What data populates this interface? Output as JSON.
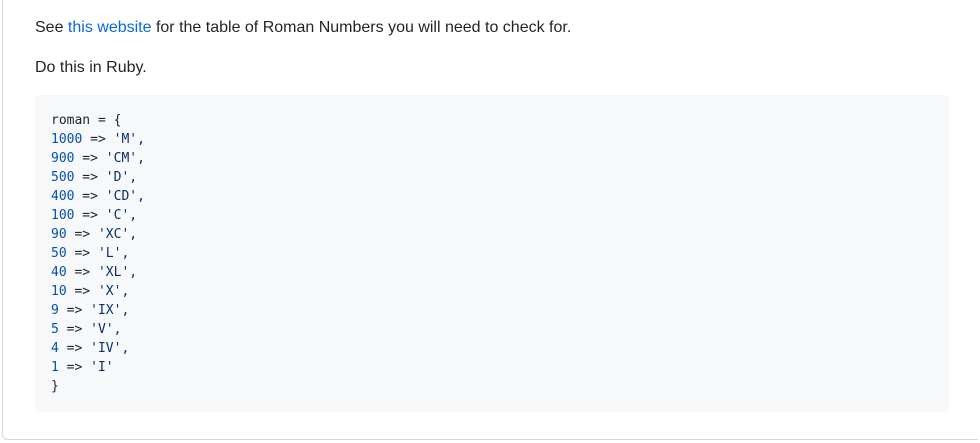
{
  "intro": {
    "prefix": "See ",
    "link_text": "this website",
    "suffix": " for the table of Roman Numbers you will need to check for."
  },
  "lang_note": "Do this in Ruby.",
  "code": {
    "open": "roman = {",
    "entries": [
      {
        "num": "1000",
        "arrow": " => ",
        "val": "'M',"
      },
      {
        "num": "900",
        "arrow": " => ",
        "val": "'CM',"
      },
      {
        "num": "500",
        "arrow": " => ",
        "val": "'D',"
      },
      {
        "num": "400",
        "arrow": " => ",
        "val": "'CD',"
      },
      {
        "num": "100",
        "arrow": " => ",
        "val": "'C',"
      },
      {
        "num": "90",
        "arrow": " => ",
        "val": "'XC',"
      },
      {
        "num": "50",
        "arrow": " => ",
        "val": "'L',"
      },
      {
        "num": "40",
        "arrow": " => ",
        "val": "'XL',"
      },
      {
        "num": "10",
        "arrow": " => ",
        "val": "'X',"
      },
      {
        "num": "9",
        "arrow": " => ",
        "val": "'IX',"
      },
      {
        "num": "5",
        "arrow": " => ",
        "val": "'V',"
      },
      {
        "num": "4",
        "arrow": " => ",
        "val": "'IV',"
      },
      {
        "num": "1",
        "arrow": " => ",
        "val": "'I'"
      }
    ],
    "close": "}"
  }
}
